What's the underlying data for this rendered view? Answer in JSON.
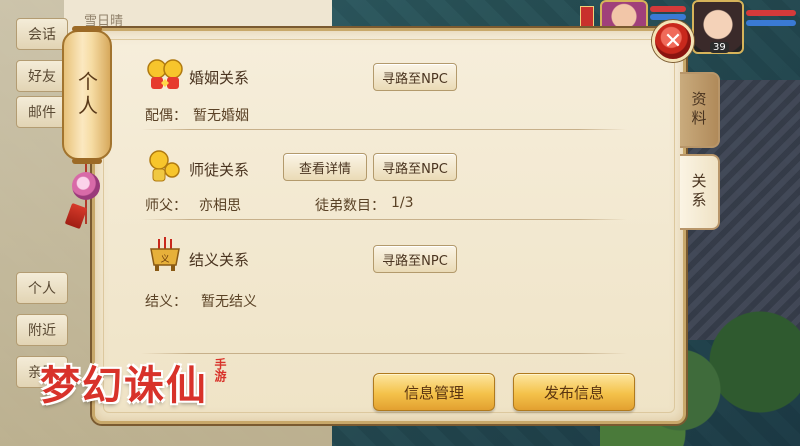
{
  "background": {
    "chat_partial_text": "雪日晴"
  },
  "hud": {
    "player_level": "39"
  },
  "left_menu": {
    "top": [
      "会话",
      "好友",
      "邮件"
    ],
    "bottom": [
      "个人",
      "附近",
      "亲朋"
    ]
  },
  "panel": {
    "lantern_title": "个人",
    "close_symbol": "✕",
    "tabs": {
      "profile": "资料",
      "relation": "关系"
    },
    "marriage": {
      "title": "婚姻关系",
      "info_label": "配偶：",
      "info_value": "暂无婚姻",
      "pathfind_button": "寻路至NPC"
    },
    "mentorship": {
      "title": "师徒关系",
      "detail_button": "查看详情",
      "pathfind_button": "寻路至NPC",
      "master_label": "师父：",
      "master_value": "亦相思",
      "disciple_label": "徒弟数目：",
      "disciple_value": "1/3"
    },
    "sworn": {
      "title": "结义关系",
      "pathfind_button": "寻路至NPC",
      "info_label": "结义：",
      "info_value": "暂无结义"
    },
    "footer": {
      "manage_button": "信息管理",
      "publish_button": "发布信息"
    }
  },
  "logo": {
    "text": "梦幻诛仙",
    "stamp": "手游"
  },
  "colors": {
    "panel_bg": "#f6eedb",
    "panel_border": "#c8a86a",
    "primary_button": "#f4c24a",
    "close_button": "#c8281c",
    "logo_red": "#d8322a"
  }
}
